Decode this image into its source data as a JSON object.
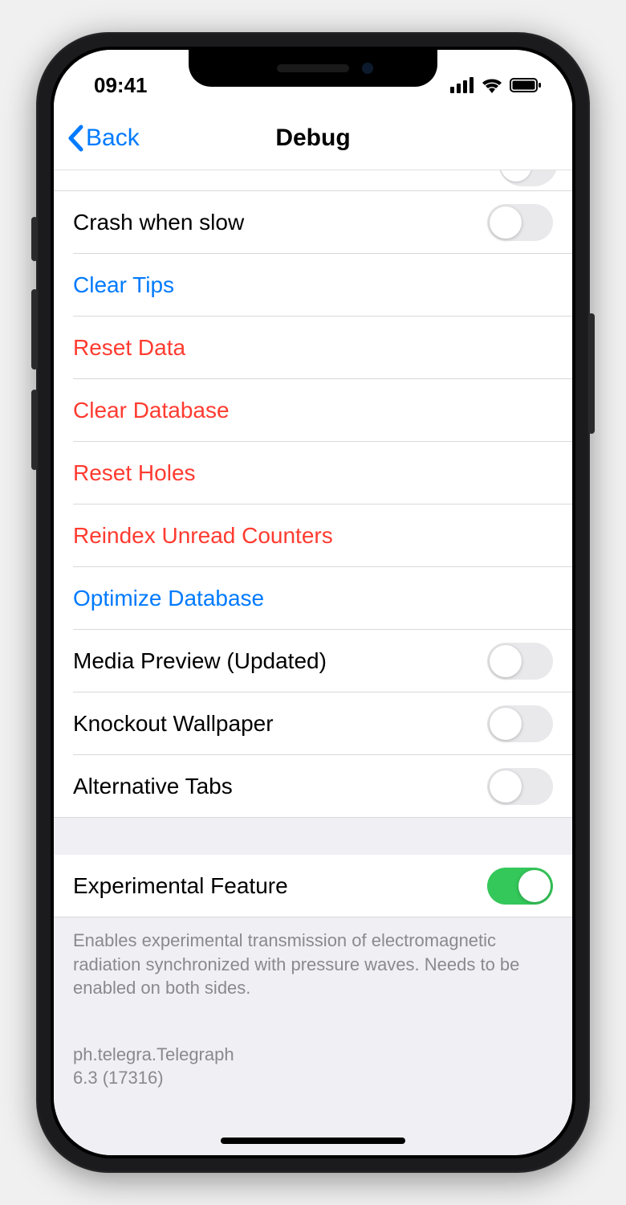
{
  "status": {
    "time": "09:41"
  },
  "nav": {
    "back_label": "Back",
    "title": "Debug"
  },
  "rows": {
    "crash_when_slow": {
      "label": "Crash when slow",
      "on": false
    },
    "clear_tips": {
      "label": "Clear Tips"
    },
    "reset_data": {
      "label": "Reset Data"
    },
    "clear_database": {
      "label": "Clear Database"
    },
    "reset_holes": {
      "label": "Reset Holes"
    },
    "reindex_unread": {
      "label": "Reindex Unread Counters"
    },
    "optimize_db": {
      "label": "Optimize Database"
    },
    "media_preview": {
      "label": "Media Preview (Updated)",
      "on": false
    },
    "knockout_wallpaper": {
      "label": "Knockout Wallpaper",
      "on": false
    },
    "alternative_tabs": {
      "label": "Alternative Tabs",
      "on": false
    },
    "experimental": {
      "label": "Experimental Feature",
      "on": true
    }
  },
  "footer": {
    "experimental_desc": "Enables experimental transmission of electromagnetic radiation synchronized with pressure waves. Needs to be enabled on both sides.",
    "bundle_id": "ph.telegra.Telegraph",
    "version": "6.3 (17316)"
  },
  "colors": {
    "link": "#007aff",
    "destructive": "#ff3b30",
    "switch_on": "#34c759"
  }
}
